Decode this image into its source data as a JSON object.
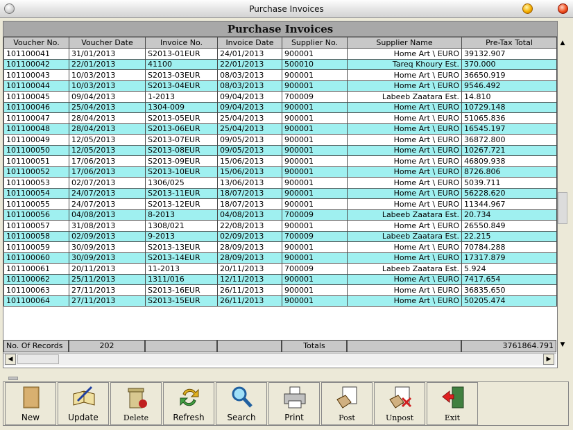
{
  "window": {
    "title": "Purchase Invoices"
  },
  "grid": {
    "title": "Purchase Invoices",
    "columns": [
      "Voucher No.",
      "Voucher Date",
      "Invoice No.",
      "Invoice Date",
      "Supplier No.",
      "Supplier Name",
      "Pre-Tax Total"
    ],
    "rows": [
      [
        "101100041",
        "31/01/2013",
        "S2013-01EUR",
        "24/01/2013",
        "900001",
        "Home Art \\ EURO",
        "39132.907"
      ],
      [
        "101100042",
        "22/01/2013",
        "41100",
        "22/01/2013",
        "500010",
        "Tareq Khoury Est.",
        "370.000"
      ],
      [
        "101100043",
        "10/03/2013",
        "S2013-03EUR",
        "08/03/2013",
        "900001",
        "Home Art \\ EURO",
        "36650.919"
      ],
      [
        "101100044",
        "10/03/2013",
        "S2013-04EUR",
        "08/03/2013",
        "900001",
        "Home Art \\ EURO",
        "9546.492"
      ],
      [
        "101100045",
        "09/04/2013",
        "1-2013",
        "09/04/2013",
        "700009",
        "Labeeb Zaatara Est.",
        "14.810"
      ],
      [
        "101100046",
        "25/04/2013",
        "1304-009",
        "09/04/2013",
        "900001",
        "Home Art \\ EURO",
        "10729.148"
      ],
      [
        "101100047",
        "28/04/2013",
        "S2013-05EUR",
        "25/04/2013",
        "900001",
        "Home Art \\ EURO",
        "51065.836"
      ],
      [
        "101100048",
        "28/04/2013",
        "S2013-06EUR",
        "25/04/2013",
        "900001",
        "Home Art \\ EURO",
        "16545.197"
      ],
      [
        "101100049",
        "12/05/2013",
        "S2013-07EUR",
        "09/05/2013",
        "900001",
        "Home Art \\ EURO",
        "36872.800"
      ],
      [
        "101100050",
        "12/05/2013",
        "S2013-08EUR",
        "09/05/2013",
        "900001",
        "Home Art \\ EURO",
        "10267.721"
      ],
      [
        "101100051",
        "17/06/2013",
        "S2013-09EUR",
        "15/06/2013",
        "900001",
        "Home Art \\ EURO",
        "46809.938"
      ],
      [
        "101100052",
        "17/06/2013",
        "S2013-10EUR",
        "15/06/2013",
        "900001",
        "Home Art \\ EURO",
        "8726.806"
      ],
      [
        "101100053",
        "02/07/2013",
        "1306/025",
        "13/06/2013",
        "900001",
        "Home Art \\ EURO",
        "5039.711"
      ],
      [
        "101100054",
        "24/07/2013",
        "S2013-11EUR",
        "18/07/2013",
        "900001",
        "Home Art \\ EURO",
        "56228.620"
      ],
      [
        "101100055",
        "24/07/2013",
        "S2013-12EUR",
        "18/07/2013",
        "900001",
        "Home Art \\ EURO",
        "11344.967"
      ],
      [
        "101100056",
        "04/08/2013",
        "8-2013",
        "04/08/2013",
        "700009",
        "Labeeb Zaatara Est.",
        "20.734"
      ],
      [
        "101100057",
        "31/08/2013",
        "1308/021",
        "22/08/2013",
        "900001",
        "Home Art \\ EURO",
        "26550.849"
      ],
      [
        "101100058",
        "02/09/2013",
        "9-2013",
        "02/09/2013",
        "700009",
        "Labeeb Zaatara Est.",
        "22.215"
      ],
      [
        "101100059",
        "30/09/2013",
        "S2013-13EUR",
        "28/09/2013",
        "900001",
        "Home Art \\ EURO",
        "70784.288"
      ],
      [
        "101100060",
        "30/09/2013",
        "S2013-14EUR",
        "28/09/2013",
        "900001",
        "Home Art \\ EURO",
        "17317.879"
      ],
      [
        "101100061",
        "20/11/2013",
        "11-2013",
        "20/11/2013",
        "700009",
        "Labeeb Zaatara Est.",
        "5.924"
      ],
      [
        "101100062",
        "25/11/2013",
        "1311/016",
        "12/11/2013",
        "900001",
        "Home Art \\ EURO",
        "7417.654"
      ],
      [
        "101100063",
        "27/11/2013",
        "S2013-16EUR",
        "26/11/2013",
        "900001",
        "Home Art \\ EURO",
        "36835.650"
      ],
      [
        "101100064",
        "27/11/2013",
        "S2013-15EUR",
        "26/11/2013",
        "900001",
        "Home Art \\ EURO",
        "50205.474"
      ]
    ],
    "footer": {
      "records_label": "No. Of Records",
      "records_count": "202",
      "totals_label": "Totals",
      "total_value": "3761864.791"
    }
  },
  "toolbar": {
    "new": "New",
    "update": "Update",
    "delete": "Delete",
    "refresh": "Refresh",
    "search": "Search",
    "print": "Print",
    "post": "Post",
    "unpost": "Unpost",
    "exit": "Exit"
  },
  "colors": {
    "row_alt": "#9ff0f0",
    "header_bg": "#c8c8c8",
    "title_bg": "#a8a8a8"
  },
  "scroll": {
    "vertical_fraction": 0.55
  }
}
